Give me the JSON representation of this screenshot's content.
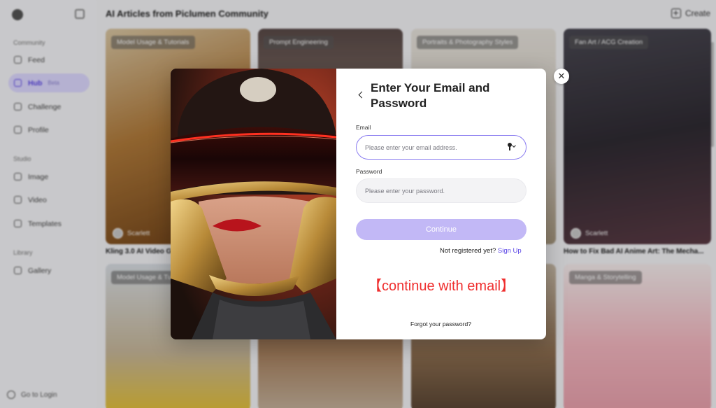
{
  "sidebar": {
    "community_label": "Community",
    "feed": "Feed",
    "hub": "Hub",
    "hub_badge": "Beta",
    "challenge": "Challenge",
    "profile": "Profile",
    "studio_label": "Studio",
    "image": "Image",
    "video": "Video",
    "templates": "Templates",
    "library_label": "Library",
    "gallery": "Gallery",
    "go_to_login": "Go to Login"
  },
  "header": {
    "title": "AI Articles from Piclumen Community",
    "create": "Create"
  },
  "cards": [
    {
      "tag": "Model Usage & Tutorials",
      "author": "Scarlett",
      "caption": "Kling 3.0 AI Video Ge"
    },
    {
      "tag": "Prompt Engineering"
    },
    {
      "tag": "Portraits & Photography Styles"
    },
    {
      "tag": "Fan Art / ACG Creation",
      "author": "Scarlett",
      "caption": "How to Fix Bad AI Anime Art: The Mecha..."
    },
    {
      "tag": "Model Usage & Tu"
    },
    {
      "tag": "Manga & Storytelling"
    }
  ],
  "modal": {
    "title": "Enter Your Email and Password",
    "email_label": "Email",
    "email_placeholder": "Please enter your email address.",
    "password_label": "Password",
    "password_placeholder": "Please enter your password.",
    "continue": "Continue",
    "not_registered": "Not registered yet?",
    "sign_up": "Sign Up",
    "annotation": "【continue with email】",
    "forgot": "Forgot your password?",
    "close": "✕"
  },
  "colors": {
    "accent": "#5b46e6",
    "button_disabled": "#c2b8f6",
    "annotation": "#ef2e2e"
  }
}
